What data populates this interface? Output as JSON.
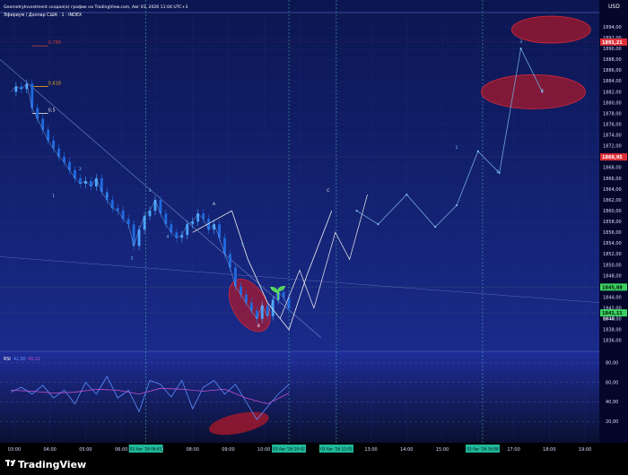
{
  "header": {
    "author_line": "GeometryInvestment создал(а) график на TradingView.com, Авг 03, 2026 11:04 UTC+3",
    "symbol_line": "Эфириум / Доллар США · 1 · INDEX"
  },
  "footer": {
    "brand": "TradingView"
  },
  "colors": {
    "background_top": "#0b1650",
    "background_bottom": "#1a2a8a",
    "candle_up": "#4aa3ff",
    "candle_down": "#1f6ae0",
    "rsi_line": "#5b8fff",
    "rsi_ma": "#c050d0",
    "ellipse": "#b0182a",
    "projection": "#e8e8e8",
    "green_tag": "#3cd060",
    "red_tag": "#e0303a"
  },
  "chart_data": [
    {
      "type": "line",
      "title": "Эфириум / Доллар США · 1 · INDEX",
      "currency": "USD",
      "ylim": [
        1834,
        1896
      ],
      "x_ticks": [
        "03:00",
        "04:00",
        "05:00",
        "06:00",
        "07:00",
        "08:00",
        "09:00",
        "10:00",
        "11:00",
        "12:00",
        "13:00",
        "14:00",
        "15:00",
        "16:00",
        "17:00",
        "18:00",
        "19:00"
      ],
      "y_ticks": [
        "1836,00",
        "1838,00",
        "1840,00",
        "1842,00",
        "1844,00",
        "1846,00",
        "1848,00",
        "1850,00",
        "1852,00",
        "1854,00",
        "1856,00",
        "1858,00",
        "1860,00",
        "1862,00",
        "1864,00",
        "1866,00",
        "1868,00",
        "1870,00",
        "1872,00",
        "1874,00",
        "1876,00",
        "1878,00",
        "1880,00",
        "1882,00",
        "1884,00",
        "1886,00",
        "1888,00",
        "1890,00",
        "1892,00",
        "1894,00"
      ],
      "price_tags": [
        {
          "label": "1891,21",
          "value": 1891.21,
          "color": "red"
        },
        {
          "label": "1869,95",
          "value": 1869.95,
          "color": "red"
        },
        {
          "label": "1845,88",
          "value": 1845.88,
          "color": "green"
        },
        {
          "label": "1841,11",
          "value": 1841.11,
          "color": "green"
        }
      ],
      "countdown": "00:18",
      "fib_levels": [
        {
          "label": "0,786",
          "value": 1890.5
        },
        {
          "label": "0,618",
          "value": 1883.0
        },
        {
          "label": "0,5",
          "value": 1878.0
        }
      ],
      "wave_labels": [
        "1",
        "2",
        "1",
        "2",
        "3",
        "4",
        "5",
        "A",
        "B",
        "C",
        "1",
        "2",
        "3",
        "4"
      ],
      "time_markers": [
        "03 Авг '26   06:41",
        "03 Авг '26   10:42",
        "03 Авг '26   12:02",
        "03 Авг '26   16:08"
      ],
      "series": [
        {
          "name": "price",
          "x": [
            2.9,
            3.05,
            3.2,
            3.35,
            3.5,
            3.65,
            3.8,
            3.95,
            4.1,
            4.25,
            4.4,
            4.55,
            4.7,
            4.85,
            5.0,
            5.15,
            5.3,
            5.45,
            5.6,
            5.75,
            5.9,
            6.05,
            6.2,
            6.35,
            6.5,
            6.65,
            6.8,
            6.95,
            7.1,
            7.25,
            7.4,
            7.55,
            7.7,
            7.85,
            8.0,
            8.15,
            8.3,
            8.45,
            8.6,
            8.75,
            8.9,
            9.05,
            9.2,
            9.35,
            9.5,
            9.65,
            9.8,
            9.95,
            10.1,
            10.25,
            10.4,
            10.55,
            10.7
          ],
          "values": [
            1882,
            1883,
            1882.5,
            1883.5,
            1879,
            1877,
            1875,
            1873,
            1871.5,
            1870,
            1869,
            1867.5,
            1866,
            1865,
            1865.5,
            1864.5,
            1866,
            1863.5,
            1862,
            1860.5,
            1860,
            1858.5,
            1857.5,
            1853.5,
            1856.5,
            1859,
            1860,
            1862,
            1859.5,
            1857.5,
            1856,
            1855,
            1855.5,
            1857.5,
            1858,
            1859.5,
            1858.5,
            1856.5,
            1857.5,
            1855,
            1852,
            1849.5,
            1846,
            1844.5,
            1843,
            1841.5,
            1840,
            1842.5,
            1840.5,
            1843.5,
            1845,
            1844,
            1842
          ]
        },
        {
          "name": "projection",
          "x": [
            12.6,
            13.2,
            14.0,
            14.8,
            15.4,
            16.0,
            16.6,
            17.2,
            17.8
          ],
          "values": [
            1860,
            1857.5,
            1863,
            1857,
            1861,
            1871,
            1867,
            1890,
            1882
          ]
        }
      ]
    },
    {
      "type": "line",
      "title": "RSI",
      "legend": [
        "RSI",
        "42,90",
        "49,11"
      ],
      "ylim": [
        0,
        90
      ],
      "y_ticks": [
        "20,00",
        "40,00",
        "60,00",
        "80,00"
      ],
      "series": [
        {
          "name": "rsi",
          "x": [
            2.9,
            3.2,
            3.5,
            3.8,
            4.1,
            4.4,
            4.7,
            5.0,
            5.3,
            5.6,
            5.9,
            6.2,
            6.5,
            6.8,
            7.1,
            7.4,
            7.7,
            8.0,
            8.3,
            8.6,
            8.9,
            9.2,
            9.5,
            9.8,
            10.1,
            10.4,
            10.7
          ],
          "values": [
            50,
            55,
            48,
            57,
            44,
            52,
            38,
            60,
            48,
            66,
            44,
            52,
            30,
            62,
            58,
            45,
            62,
            33,
            55,
            62,
            48,
            58,
            40,
            22,
            35,
            48,
            58
          ]
        },
        {
          "name": "rsi-ma",
          "x": [
            2.9,
            3.5,
            4.1,
            4.7,
            5.3,
            5.9,
            6.5,
            7.1,
            7.7,
            8.3,
            8.9,
            9.5,
            10.1,
            10.7
          ],
          "values": [
            52,
            51,
            49,
            50,
            53,
            52,
            48,
            54,
            53,
            51,
            53,
            44,
            38,
            49
          ]
        }
      ]
    }
  ]
}
